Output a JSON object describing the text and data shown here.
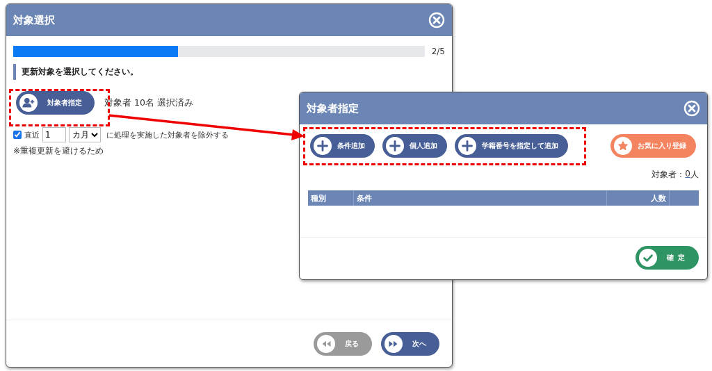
{
  "main_dialog": {
    "title": "対象選択",
    "progress": {
      "level": 0.4,
      "label": "2/5"
    },
    "instruction": "更新対象を選択してください。",
    "target_button": "対象者指定",
    "selection_status": "対象者 10名 選択済み",
    "exclude_option": {
      "checked": true,
      "prefix": "直近",
      "count": "1",
      "unit": "カ月",
      "suffix": "に処理を実施した対象者を除外する"
    },
    "note": "※重複更新を避けるため",
    "buttons": [
      {
        "label": "戻る",
        "kind": "back"
      },
      {
        "label": "次へ",
        "kind": "next"
      }
    ]
  },
  "sub_dialog": {
    "title": "対象者指定",
    "add_buttons": [
      "条件追加",
      "個人追加",
      "学籍番号を指定して追加"
    ],
    "favorite_button": "お気に入り登録",
    "count_label": "対象者：",
    "count": "0",
    "count_unit": "人",
    "table": {
      "columns": [
        "種別",
        "条件",
        "人数"
      ]
    },
    "confirm_button": "確定"
  }
}
